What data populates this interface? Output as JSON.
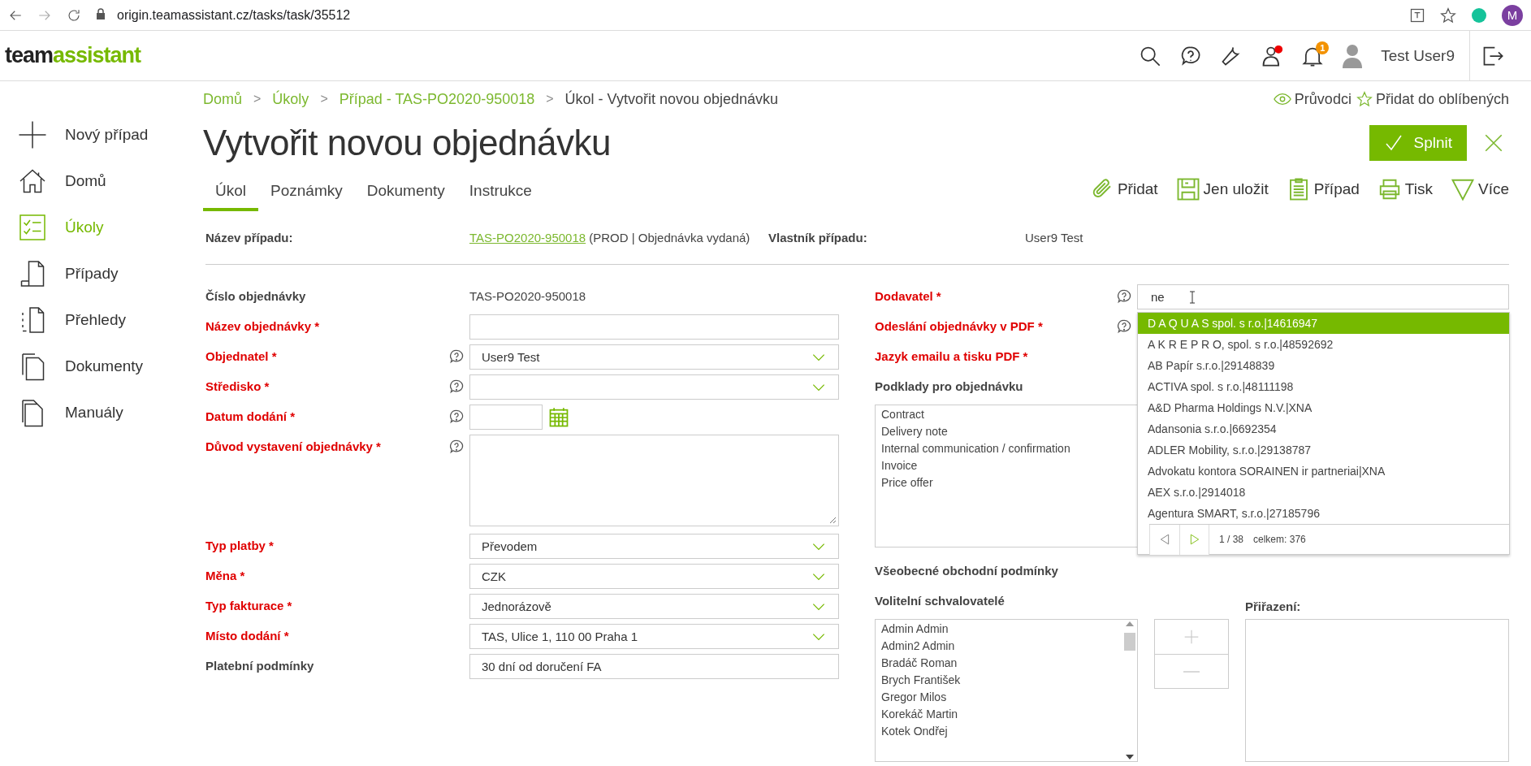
{
  "browser": {
    "url": "origin.teamassistant.cz/tasks/task/35512",
    "profile_initial": "M"
  },
  "header": {
    "logo_first": "team",
    "logo_second": "assistant",
    "user_name": "Test User9",
    "badge": "1"
  },
  "sidebar": {
    "items": [
      {
        "label": "Nový případ",
        "selected": false
      },
      {
        "label": "Domů",
        "selected": false
      },
      {
        "label": "Úkoly",
        "selected": true
      },
      {
        "label": "Případy",
        "selected": false
      },
      {
        "label": "Přehledy",
        "selected": false
      },
      {
        "label": "Dokumenty",
        "selected": false
      },
      {
        "label": "Manuály",
        "selected": false
      }
    ]
  },
  "breadcrumbs": [
    {
      "label": "Domů",
      "kind": "link"
    },
    {
      "label": "Úkoly",
      "kind": "link"
    },
    {
      "label": "Případ - TAS-PO2020-950018",
      "kind": "link"
    },
    {
      "label": "Úkol - Vytvořit novou objednávku",
      "kind": "current"
    }
  ],
  "breadcrumb_separator": ">",
  "top_links": [
    "Průvodci",
    "Přidat do oblíbených"
  ],
  "title": "Vytvořit novou objednávku",
  "complete_button": "Splnit",
  "tabs": [
    {
      "label": "Úkol",
      "selected": true
    },
    {
      "label": "Poznámky",
      "selected": false
    },
    {
      "label": "Dokumenty",
      "selected": false
    },
    {
      "label": "Instrukce",
      "selected": false
    }
  ],
  "actions": [
    "Přidat",
    "Jen uložit",
    "Případ",
    "Tisk",
    "Více"
  ],
  "case_info": {
    "name_label": "Název případu:",
    "case_link": "TAS-PO2020-950018",
    "case_suffix": "(PROD | Objednávka vydaná)",
    "owner_label": "Vlastník případu:",
    "owner_value": "User9 Test"
  },
  "left_fields": [
    {
      "label": "Číslo objednávky",
      "required": false,
      "help": false,
      "kind": "text",
      "value": "TAS-PO2020-950018"
    },
    {
      "label": "Název objednávky *",
      "required": true,
      "help": false,
      "kind": "input"
    },
    {
      "label": "Objednatel *",
      "required": true,
      "help": true,
      "kind": "select",
      "value": "User9 Test"
    },
    {
      "label": "Středisko *",
      "required": true,
      "help": true,
      "kind": "select"
    },
    {
      "label": "Datum dodání *",
      "required": true,
      "help": true,
      "kind": "date"
    },
    {
      "label": "Důvod vystavení objednávky *",
      "required": true,
      "help": true,
      "kind": "textarea"
    },
    {
      "label": "Typ platby *",
      "required": true,
      "help": false,
      "kind": "select",
      "value": "Převodem"
    },
    {
      "label": "Měna *",
      "required": true,
      "help": false,
      "kind": "select",
      "value": "CZK"
    },
    {
      "label": "Typ fakturace *",
      "required": true,
      "help": false,
      "kind": "select",
      "value": "Jednorázově"
    },
    {
      "label": "Místo dodání *",
      "required": true,
      "help": false,
      "kind": "select",
      "value": "TAS, Ulice 1, 110 00 Praha 1"
    },
    {
      "label": "Platební podmínky",
      "required": false,
      "help": false,
      "kind": "input",
      "value": "30 dní od doručení FA"
    }
  ],
  "right_fields": [
    {
      "label": "Dodavatel *",
      "required": true,
      "help": true
    },
    {
      "label": "Odeslání objednávky v PDF *",
      "required": true,
      "help": true
    },
    {
      "label": "Jazyk emailu a tisku PDF *",
      "required": true,
      "help": false
    }
  ],
  "supplier_value": "ne",
  "documents": {
    "label": "Podklady pro objednávku",
    "items": [
      "Contract",
      "Delivery note",
      "Internal communication / confirmation",
      "Invoice",
      "Price offer"
    ]
  },
  "terms_label": "Všeobecné obchodní podmínky",
  "approvers": {
    "label": "Volitelní schvalovatelé",
    "items": [
      "Admin Admin",
      "Admin2 Admin",
      "Bradáč Roman",
      "Brych František",
      "Gregor Milos",
      "Korekáč Martin",
      "Kotek Ondřej"
    ]
  },
  "assigned_label": "Přiřazení:",
  "dropdown": {
    "options": [
      {
        "label": "D A Q U A S spol. s r.o.|14616947",
        "selected": true
      },
      {
        "label": "A K R E P R O, spol. s r.o.|48592692",
        "selected": false
      },
      {
        "label": "AB Papír s.r.o.|29148839",
        "selected": false
      },
      {
        "label": "ACTIVA spol. s r.o.|48111198",
        "selected": false
      },
      {
        "label": "A&D Pharma Holdings N.V.|XNA",
        "selected": false
      },
      {
        "label": "Adansonia s.r.o.|6692354",
        "selected": false
      },
      {
        "label": "ADLER Mobility, s.r.o.|29138787",
        "selected": false
      },
      {
        "label": "Advokatu kontora SORAINEN ir partneriai|XNA",
        "selected": false
      },
      {
        "label": "AEX s.r.o.|2914018",
        "selected": false
      },
      {
        "label": "Agentura SMART, s.r.o.|27185796",
        "selected": false
      }
    ],
    "page": "1 / 38",
    "total": "celkem: 376"
  }
}
